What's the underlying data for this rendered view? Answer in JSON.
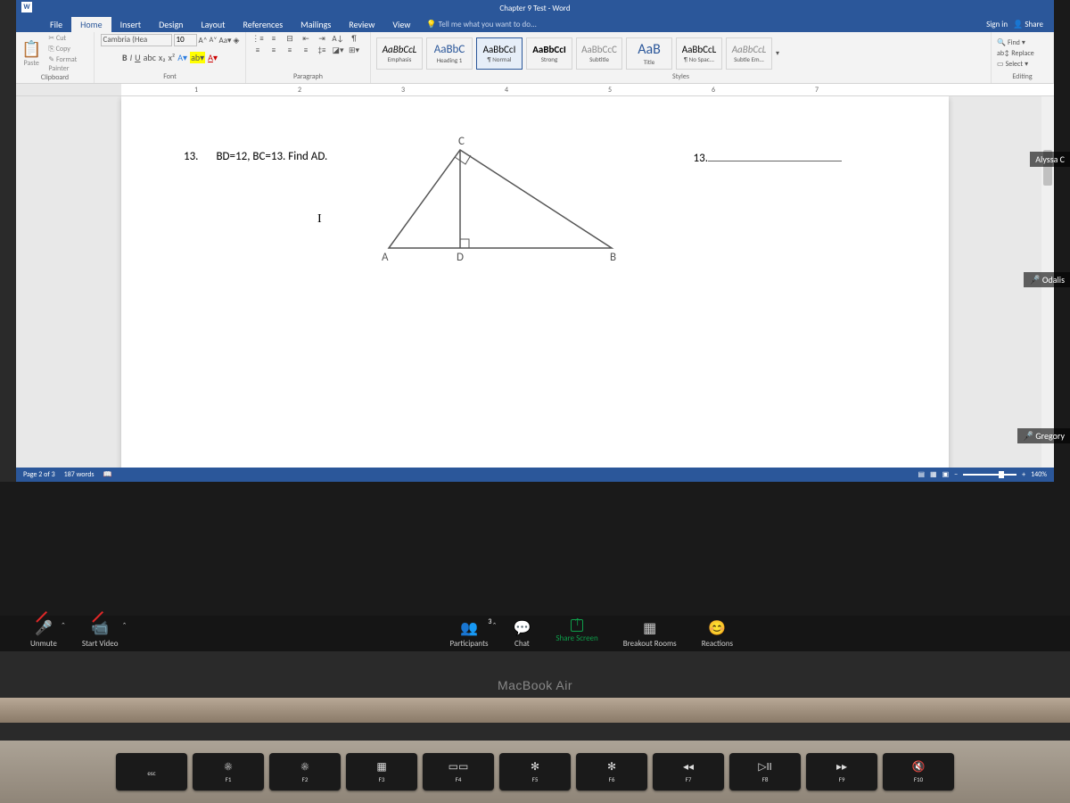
{
  "titlebar": {
    "doc": "Chapter 9 Test - Word",
    "signin": "Sign in",
    "share": "Share"
  },
  "tabs": {
    "file": "File",
    "home": "Home",
    "insert": "Insert",
    "design": "Design",
    "layout": "Layout",
    "references": "References",
    "mailings": "Mailings",
    "review": "Review",
    "view": "View",
    "tellme": "Tell me what you want to do..."
  },
  "ribbon": {
    "clipboard": {
      "paste": "Paste",
      "cut": "Cut",
      "copy": "Copy",
      "painter": "Format Painter",
      "label": "Clipboard"
    },
    "font": {
      "name": "Cambria (Hea",
      "size": "10",
      "label": "Font"
    },
    "paragraph": {
      "label": "Paragraph"
    },
    "styles": {
      "items": [
        {
          "sample": "AaBbCcL",
          "name": "Emphasis"
        },
        {
          "sample": "AaBbC",
          "name": "Heading 1"
        },
        {
          "sample": "AaBbCcI",
          "name": "¶ Normal"
        },
        {
          "sample": "AaBbCcI",
          "name": "Strong"
        },
        {
          "sample": "AaBbCcC",
          "name": "Subtitle"
        },
        {
          "sample": "AaB",
          "name": "Title"
        },
        {
          "sample": "AaBbCcL",
          "name": "¶ No Spac..."
        },
        {
          "sample": "AaBbCcL",
          "name": "Subtle Em..."
        }
      ],
      "label": "Styles"
    },
    "editing": {
      "find": "Find",
      "replace": "Replace",
      "select": "Select",
      "label": "Editing"
    }
  },
  "ruler": [
    "1",
    "2",
    "3",
    "4",
    "5",
    "6",
    "7"
  ],
  "document": {
    "problem_num": "13.",
    "problem_text": "BD=12, BC=13. Find AD.",
    "answer_num": "13.",
    "letter_i": "I",
    "tri": {
      "A": "A",
      "B": "B",
      "C": "C",
      "D": "D"
    }
  },
  "statusbar": {
    "page": "Page 2 of 3",
    "words": "187 words",
    "zoom": "140%"
  },
  "participants": {
    "alyssa": "Alyssa C",
    "odalis": "Odalis",
    "gregory": "Gregory"
  },
  "zoombar": {
    "unmute": "Unmute",
    "video": "Start Video",
    "participants": "Participants",
    "participants_count": "3",
    "chat": "Chat",
    "share": "Share Screen",
    "breakout": "Breakout Rooms",
    "reactions": "Reactions"
  },
  "macbook": "MacBook Air",
  "fnkeys": [
    {
      "sym": "",
      "lbl": "esc"
    },
    {
      "sym": "☀",
      "lbl": "F1"
    },
    {
      "sym": "☀",
      "lbl": "F2"
    },
    {
      "sym": "▦",
      "lbl": "F3"
    },
    {
      "sym": "▭▭",
      "lbl": "F4"
    },
    {
      "sym": "✻",
      "lbl": "F5"
    },
    {
      "sym": "✻",
      "lbl": "F6"
    },
    {
      "sym": "◂◂",
      "lbl": "F7"
    },
    {
      "sym": "▷II",
      "lbl": "F8"
    },
    {
      "sym": "▸▸",
      "lbl": "F9"
    },
    {
      "sym": "🔇",
      "lbl": "F10"
    }
  ]
}
